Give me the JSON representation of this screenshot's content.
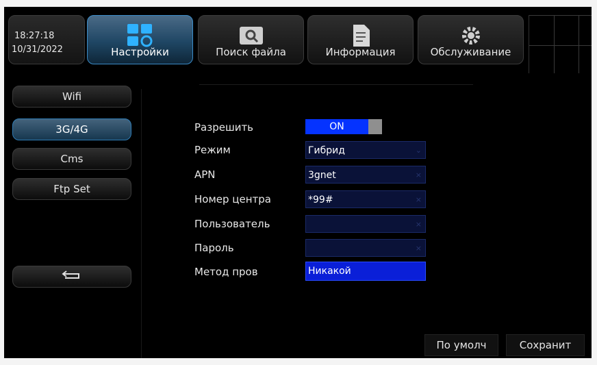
{
  "clock": {
    "time": "18:27:18",
    "date": "10/31/2022"
  },
  "tabs": [
    {
      "label": "Настройки",
      "icon": "settings-icon",
      "active": true
    },
    {
      "label": "Поиск файла",
      "icon": "video-search-icon"
    },
    {
      "label": "Информация",
      "icon": "document-icon"
    },
    {
      "label": "Обслуживание",
      "icon": "gear-icon"
    }
  ],
  "sidebar": {
    "items": [
      {
        "label": "Wifi"
      },
      {
        "label": "3G/4G",
        "active": true
      },
      {
        "label": "Cms"
      },
      {
        "label": "Ftp Set"
      }
    ],
    "back_icon": "back-arrow-icon"
  },
  "form": {
    "enable": {
      "label": "Разрешить",
      "value": "ON"
    },
    "mode": {
      "label": "Режим",
      "value": "Гибрид"
    },
    "apn": {
      "label": "APN",
      "value": "3gnet"
    },
    "center_number": {
      "label": "Номер центра",
      "value": "*99#"
    },
    "user": {
      "label": "Пользователь",
      "value": ""
    },
    "password": {
      "label": "Пароль",
      "value": ""
    },
    "auth_method": {
      "label": "Метод пров",
      "value": "Никакой"
    }
  },
  "actions": {
    "default_label": "По умолч",
    "save_label": "Сохранит"
  },
  "colors": {
    "accent": "#0533ff",
    "field": "#0a1238",
    "active_tab": "#1f4664"
  }
}
